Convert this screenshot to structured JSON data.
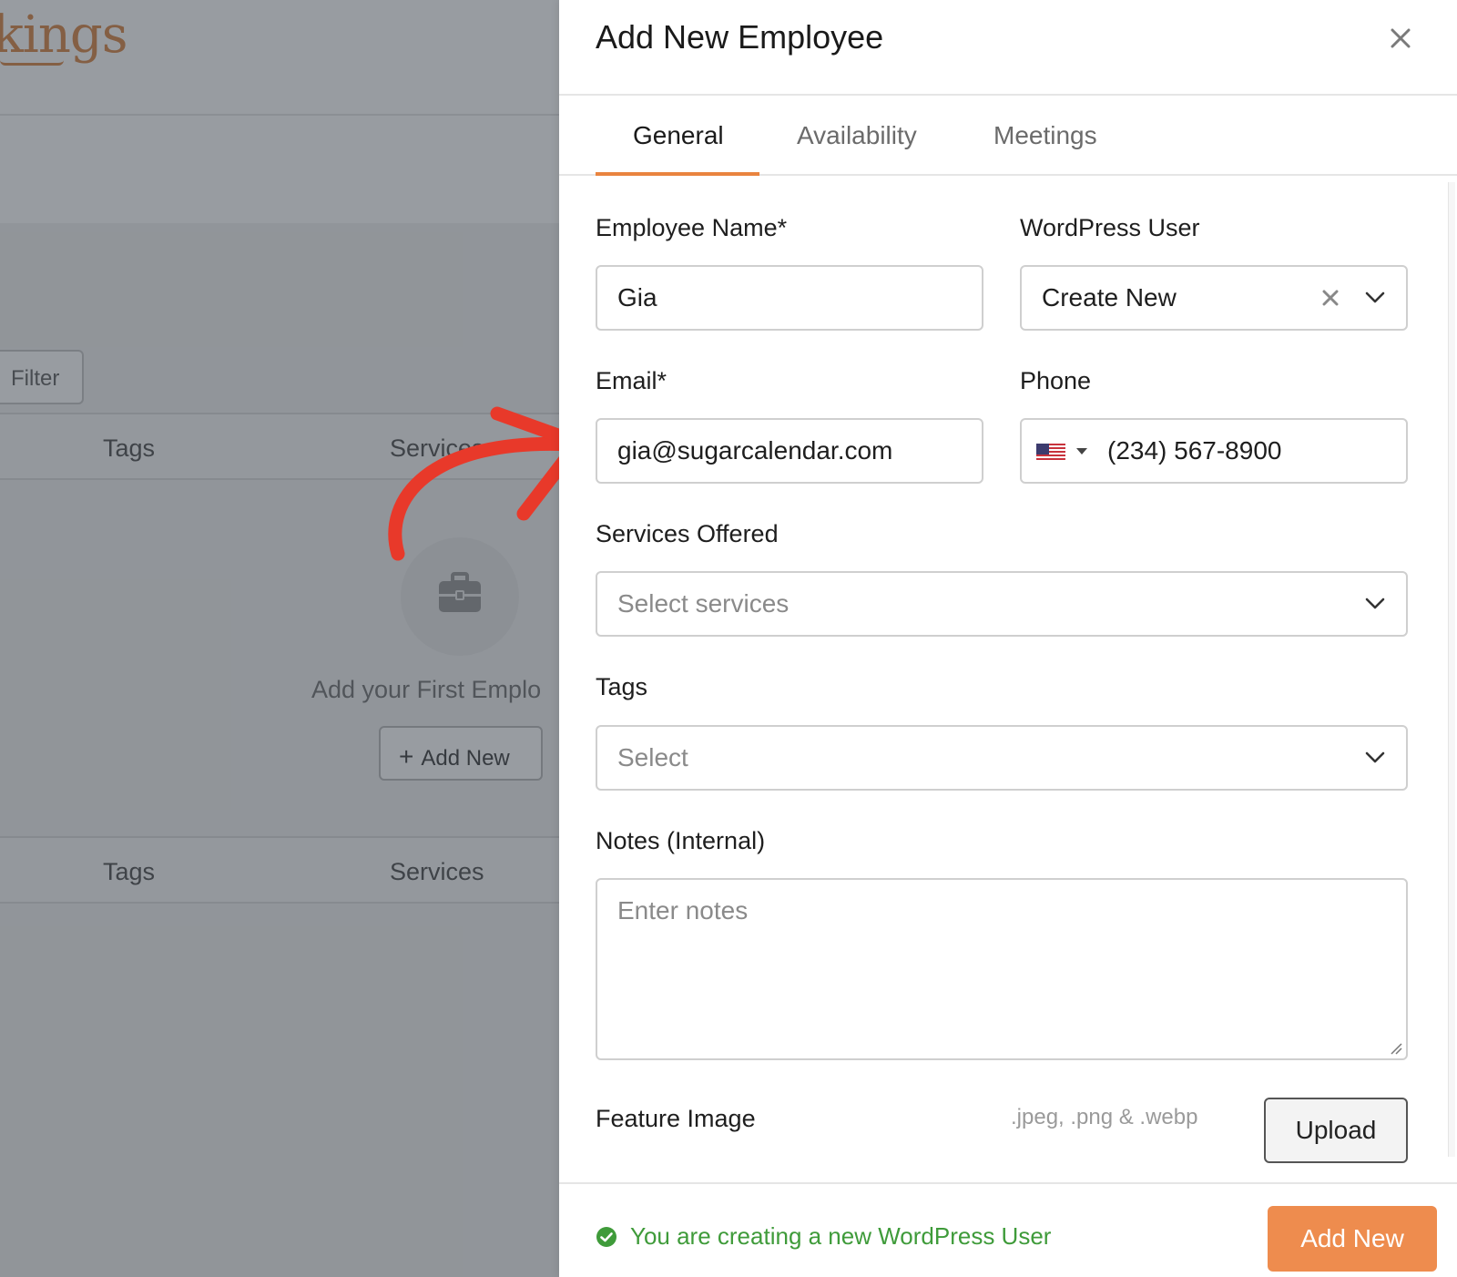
{
  "background": {
    "logo_text": "kings",
    "filter_label": "Filter",
    "table_headers": [
      "Tags",
      "Services"
    ],
    "empty_state_text": "Add your First Emplo",
    "add_button_label": "Add New"
  },
  "drawer": {
    "title": "Add New Employee",
    "tabs": [
      {
        "label": "General",
        "active": true
      },
      {
        "label": "Availability",
        "active": false
      },
      {
        "label": "Meetings",
        "active": false
      }
    ],
    "fields": {
      "employee_name_label": "Employee Name*",
      "employee_name_value": "Gia",
      "wordpress_user_label": "WordPress User",
      "wordpress_user_value": "Create New",
      "email_label": "Email*",
      "email_value": "gia@sugarcalendar.com",
      "phone_label": "Phone",
      "phone_value": "(234) 567-8900",
      "phone_country_icon": "us-flag-icon",
      "services_label": "Services Offered",
      "services_placeholder": "Select services",
      "tags_label": "Tags",
      "tags_placeholder": "Select",
      "notes_label": "Notes (Internal)",
      "notes_placeholder": "Enter notes",
      "feature_image_label": "Feature Image",
      "feature_image_hint": ".jpeg, .png & .webp",
      "upload_label": "Upload"
    },
    "footer": {
      "notice": "You are creating a new WordPress User",
      "submit_label": "Add New"
    }
  },
  "colors": {
    "accent": "#ee8c4e",
    "tab_underline": "#e9843f",
    "success": "#3f9b3a",
    "annotation_arrow": "#e8392a"
  }
}
